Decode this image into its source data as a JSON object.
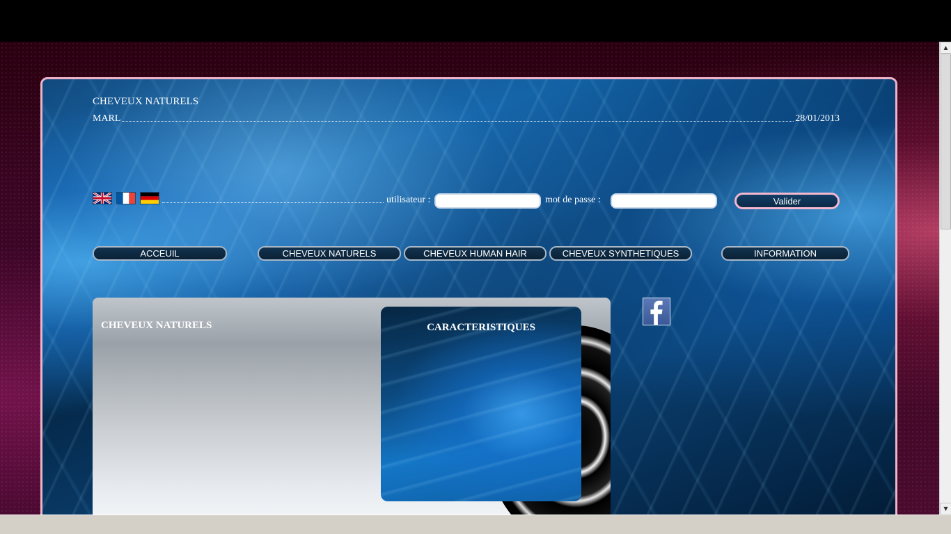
{
  "header": {
    "site_title": "CHEVEUX NATURELS",
    "company": "MARL",
    "date": "28/01/2013"
  },
  "languages": [
    {
      "name": "english-flag-icon"
    },
    {
      "name": "french-flag-icon"
    },
    {
      "name": "german-flag-icon"
    }
  ],
  "login": {
    "user_label": "utilisateur :",
    "user_value": "",
    "password_label": "mot de passe :",
    "password_value": "",
    "submit_label": "Valider"
  },
  "nav": {
    "home": "ACCEUIL",
    "natural": "CHEVEUX NATURELS",
    "human_hair": "CHEVEUX HUMAN HAIR",
    "synthetic": "CHEVEUX SYNTHETIQUES",
    "info": "INFORMATION"
  },
  "content": {
    "title": "CHEVEUX NATURELS",
    "features_title": "CARACTERISTIQUES"
  },
  "social": {
    "icon": "facebook-icon"
  },
  "colors": {
    "frame_border": "#f0b4c8",
    "accent_blue": "#1476c6",
    "facebook_blue": "#3b5998"
  }
}
